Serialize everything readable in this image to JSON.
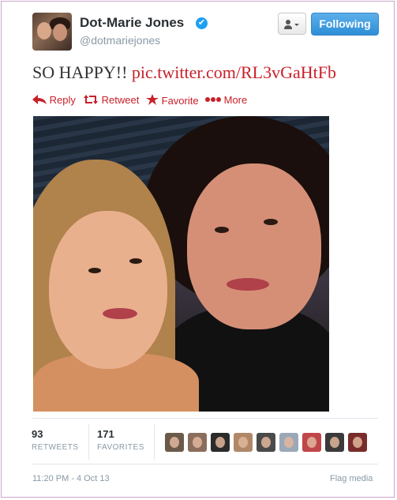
{
  "header": {
    "display_name": "Dot-Marie Jones",
    "verified_mark": "✔",
    "handle": "@dotmariejones",
    "user_menu_icon": "user-dropdown-icon",
    "follow_label": "Following"
  },
  "tweet": {
    "text": "SO HAPPY!! ",
    "link": "pic.twitter.com/RL3vGaHtFb",
    "link_color": "#c8202a"
  },
  "actions": {
    "reply": "Reply",
    "retweet": "Retweet",
    "favorite": "Favorite",
    "more": "More"
  },
  "stats": {
    "retweets_count": "93",
    "retweets_label": "RETWEETS",
    "favorites_count": "171",
    "favorites_label": "FAVORITES"
  },
  "favoriters": [
    {
      "color": "#6b5a4a"
    },
    {
      "color": "#8a6d5c"
    },
    {
      "color": "#2b2b2b"
    },
    {
      "color": "#b08868"
    },
    {
      "color": "#4a4a4a"
    },
    {
      "color": "#9aa8b8"
    },
    {
      "color": "#c0464a"
    },
    {
      "color": "#3a3a3a"
    },
    {
      "color": "#7a2b2b"
    }
  ],
  "footer": {
    "timestamp": "11:20 PM - 4 Oct 13",
    "flag_media": "Flag media"
  },
  "colors": {
    "accent": "#c8202a",
    "follow_button": "#2d8ed6",
    "muted_text": "#8899a6"
  }
}
